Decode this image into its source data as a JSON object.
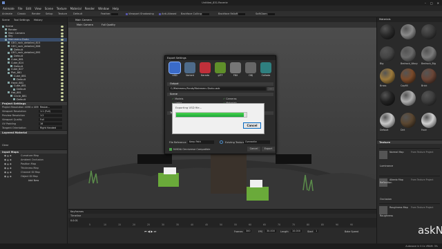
{
  "window": {
    "title": "Untitled_831.Reverie"
  },
  "menu": [
    "Animate",
    "File",
    "Edit",
    "View",
    "Scene",
    "Texture",
    "Material",
    "Render",
    "Window",
    "Help"
  ],
  "header_tabs": [
    "Animate",
    "Classic",
    "Render",
    "Setup",
    "Texture",
    "Default"
  ],
  "toolbar": {
    "feather": "Feather",
    "viewport_shadowing": "Viewport Shadowing",
    "anti_aliased": "Anti-Aliased",
    "backface_culling": "Backface Culling",
    "backface_falloff": "Backface Falloff",
    "soft_glam": "SoftGlam"
  },
  "left_tabs": [
    "Scene",
    "Tool Settings",
    "History"
  ],
  "scene_tree": [
    "Scene",
    "Render",
    "Main Camera",
    "Sky",
    "Mainmenu Dudo",
    "GEO_rock_detailed_815",
    "GEO_rock_detailed_808",
    "Default",
    "GEO_rock_detailed_895",
    "Default",
    "Cube_881",
    "Cube_824",
    "Default",
    "Cube_827",
    "Plat_881",
    "Cube_881",
    "Default",
    "Hand_881",
    "Cube_881",
    "Default",
    "Hat_881",
    "Circle_881",
    "Default"
  ],
  "project_settings": {
    "header": "Project Settings",
    "rows": [
      {
        "label": "Project Resolution  4096 x 4096",
        "value": "Resize..."
      },
      {
        "label": "Viewport Resolution",
        "value": "1:1 (Full)"
      },
      {
        "label": "Preview Resolution",
        "value": "1:2"
      },
      {
        "label": "Viewport Quality",
        "value": "Full"
      },
      {
        "label": "UV Padding",
        "value": "16"
      },
      {
        "label": "Tangent Orientation",
        "value": "Right Handed"
      }
    ]
  },
  "layers": {
    "header": "Layered Material",
    "clear": "Clear"
  },
  "input_maps": {
    "header": "Input Maps",
    "rows": [
      "Curvature Map",
      "Ambient Occlusion",
      "Position Map",
      "Thickness Map",
      "Channel ID Map",
      "Object ID Map"
    ],
    "add_new": "Add New"
  },
  "viewport": {
    "tabs": [
      "Main Camera"
    ],
    "bar": [
      "Main Camera",
      "Full Quality"
    ]
  },
  "export_dialog": {
    "title": "Export Settings",
    "formats": [
      {
        "label": "USD",
        "color": "#3a6bc9"
      },
      {
        "label": "Variant",
        "color": "#4e6b8a"
      },
      {
        "label": "Karada",
        "color": "#c0303a"
      },
      {
        "label": "glTF",
        "color": "#5f8f2a"
      },
      {
        "label": "FBX",
        "color": "#777777"
      },
      {
        "label": "OBJ",
        "color": "#666666"
      },
      {
        "label": "Collada",
        "color": "#2f7f7f"
      }
    ],
    "output_header": "Output",
    "output_path": "C:/Mainmenu/Fonds/Mainmenu Dudo.usdc",
    "scene_header": "Scene",
    "options": [
      "Models",
      "Cameras",
      "Lights",
      "Materials",
      "Animation",
      "Hidden Objects"
    ],
    "textures_header": "Textures",
    "file_reference": "File Reference",
    "file_reference_value": "Keep Path",
    "existing_textures": "Existing Textures",
    "existing_textures_value": "Overwrite",
    "nvidia": "NVIDIA Omniverse Compatible",
    "cancel": "Cancel",
    "export": "Export"
  },
  "progress": {
    "text": "Exporting USD file...",
    "percent": 0.96,
    "cancel": "Cancel"
  },
  "materials": {
    "header": "Materials",
    "items": [
      {
        "name": "",
        "color": "#2a2a2a"
      },
      {
        "name": "",
        "color": "#8a8a8a"
      },
      {
        "name": "",
        "color": "#3a3a3a"
      },
      {
        "name": "Big",
        "color": "#444444"
      },
      {
        "name": "Bedrock_Wavy",
        "color": "#6a6a6a"
      },
      {
        "name": "Bedrock_Big",
        "color": "#7a7a7a"
      },
      {
        "name": "Brass",
        "color": "#9c7a3c"
      },
      {
        "name": "Capfill",
        "color": "#7a4a2a"
      },
      {
        "name": "Brick",
        "color": "#6a4536"
      },
      {
        "name": "",
        "color": "#222222"
      },
      {
        "name": "",
        "color": "#b0b0b0"
      },
      {
        "name": "",
        "color": "#3d3d3d"
      },
      {
        "name": "Default",
        "color": "#c8c8c8"
      },
      {
        "name": "Dirt",
        "color": "#5a4630"
      },
      {
        "name": "Face",
        "color": "#d0d0d0"
      }
    ]
  },
  "texture_panel": {
    "header": "Texture",
    "rows": [
      {
        "label": "Normal Map",
        "value": "From Texture Project"
      },
      {
        "label": "Albedo Map",
        "value": "From Texture Project"
      },
      {
        "label": "Roughness Map",
        "value": "From Texture Project"
      }
    ],
    "labels": [
      "Luminance",
      "Reflection",
      "Occlusion",
      "Roughness"
    ]
  },
  "timeline": {
    "header": "Keyframes",
    "label": "Timeline",
    "current": "0.0.01",
    "ticks": [
      "5",
      "10",
      "15",
      "20",
      "25",
      "30",
      "35",
      "40",
      "45",
      "50",
      "55",
      "60",
      "65",
      "70",
      "75",
      "80",
      "85",
      "90",
      "95"
    ]
  },
  "transport": {
    "frames": "Frames",
    "frames_value": "300",
    "fps": "FPS",
    "fps_value": "30.000",
    "length": "Length",
    "length_value": "10.000",
    "start": "Start",
    "start_value": "1",
    "bake": "Bake Speed"
  },
  "status": {
    "text": "Autosave in 0:1s  VRAM: 3%"
  },
  "watermark": "askNK"
}
